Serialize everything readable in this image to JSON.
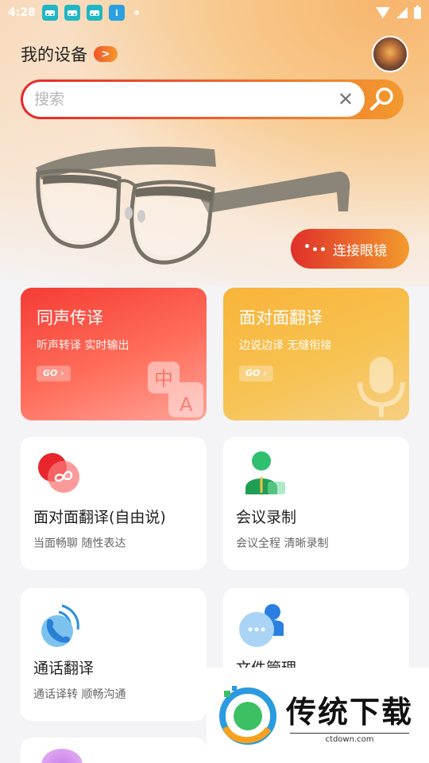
{
  "status_bar": {
    "time": "4:28",
    "info_app_glyph": "i"
  },
  "header": {
    "title": "我的设备",
    "arrow_glyph": ">"
  },
  "search": {
    "placeholder": "搜索",
    "clear_glyph": "✕"
  },
  "connect_button": {
    "label": "连接眼镜"
  },
  "feature_cards": [
    {
      "title": "同声传译",
      "subtitle": "听声转译 实时输出",
      "go": "GO",
      "deco_zh": "中",
      "deco_en": "A"
    },
    {
      "title": "面对面翻译",
      "subtitle": "边说边译 无缝衔接",
      "go": "GO"
    }
  ],
  "tool_cards": [
    {
      "title": "面对面翻译(自由说)",
      "subtitle": "当面畅聊 随性表达"
    },
    {
      "title": "会议录制",
      "subtitle": "会议全程 清晰录制"
    },
    {
      "title": "通话翻译",
      "subtitle": "通话译转  顺畅沟通"
    },
    {
      "title": "文件管理",
      "subtitle": ""
    }
  ],
  "watermark": {
    "brand": "传统下载",
    "url": "ctdown.com"
  },
  "colors": {
    "accent_red": "#e8262b",
    "accent_orange": "#f39a2e"
  }
}
